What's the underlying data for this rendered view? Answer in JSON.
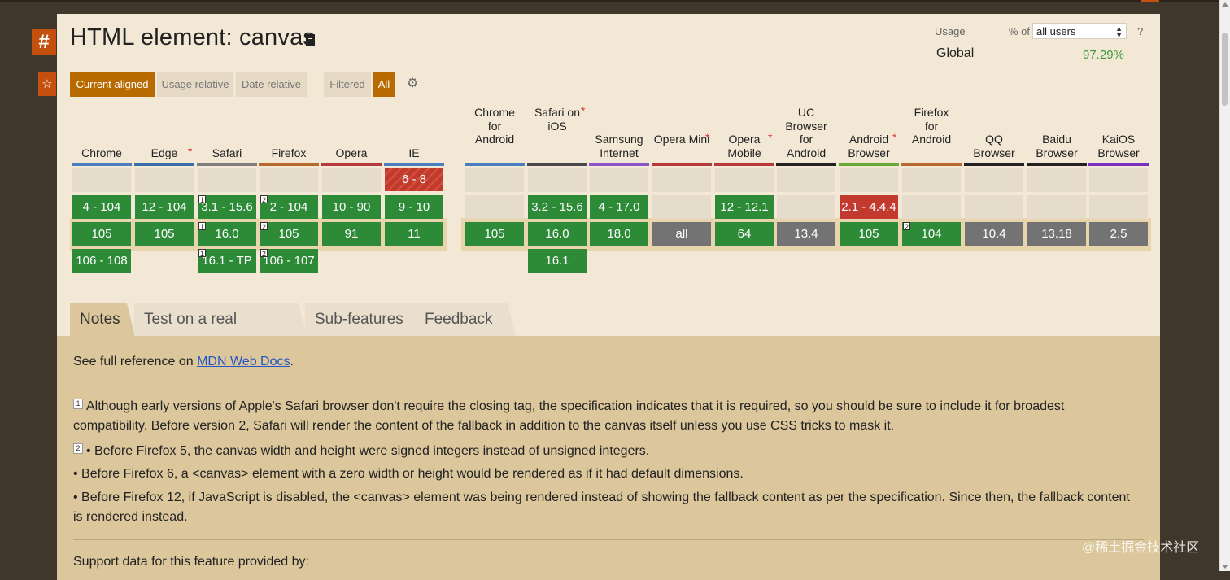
{
  "title": "HTML element: canvas",
  "anchor_label": "#",
  "star_label": "☆",
  "view_buttons": [
    "Current aligned",
    "Usage relative",
    "Date relative"
  ],
  "filter_buttons": [
    "Filtered",
    "All"
  ],
  "usage": {
    "label": "Usage",
    "pct_of": "% of",
    "users_value": "all users",
    "help": "?",
    "region": "Global",
    "percent": "97.29%"
  },
  "browsers": [
    {
      "name": "Chrome",
      "star": false,
      "color": "#4a7fbf",
      "cells": [
        "",
        "4 - 104",
        "105",
        "106 - 108"
      ],
      "notes": [
        "",
        "",
        "",
        ""
      ],
      "status": [
        "empty",
        "green",
        "green",
        "green"
      ]
    },
    {
      "name": "Edge",
      "star": true,
      "color": "#3a6ea8",
      "cells": [
        "",
        "12 - 104",
        "105",
        ""
      ],
      "notes": [
        "",
        "",
        "",
        ""
      ],
      "status": [
        "empty",
        "green",
        "green",
        "none"
      ]
    },
    {
      "name": "Safari",
      "star": false,
      "color": "#7d7d7d",
      "cells": [
        "",
        "3.1 - 15.6",
        "16.0",
        "16.1 - TP"
      ],
      "notes": [
        "",
        "1",
        "1",
        "1"
      ],
      "status": [
        "empty",
        "green",
        "green",
        "green"
      ]
    },
    {
      "name": "Firefox",
      "star": false,
      "color": "#b8692f",
      "cells": [
        "",
        "2 - 104",
        "105",
        "106 - 107"
      ],
      "notes": [
        "",
        "2",
        "2",
        "2"
      ],
      "status": [
        "empty",
        "green",
        "green",
        "green"
      ]
    },
    {
      "name": "Opera",
      "star": false,
      "color": "#b53a3a",
      "cells": [
        "",
        "10 - 90",
        "91",
        ""
      ],
      "notes": [
        "",
        "",
        "",
        ""
      ],
      "status": [
        "empty",
        "green",
        "green",
        "none"
      ]
    },
    {
      "name": "IE",
      "star": false,
      "color": "#4a7fbf",
      "cells": [
        "6 - 8",
        "9 - 10",
        "11",
        ""
      ],
      "notes": [
        "",
        "",
        "",
        ""
      ],
      "status": [
        "redh",
        "green",
        "green",
        "none"
      ]
    },
    {
      "name": "Chrome for Android",
      "star": false,
      "color": "#4a7fbf",
      "cells": [
        "",
        "",
        "105",
        ""
      ],
      "notes": [
        "",
        "",
        "",
        ""
      ],
      "status": [
        "empty",
        "empty",
        "green",
        "none"
      ]
    },
    {
      "name": "Safari on iOS",
      "star": true,
      "color": "#4a4a4a",
      "cells": [
        "",
        "3.2 - 15.6",
        "16.0",
        "16.1"
      ],
      "notes": [
        "",
        "",
        "",
        ""
      ],
      "status": [
        "empty",
        "green",
        "green",
        "green"
      ]
    },
    {
      "name": "Samsung Internet",
      "star": false,
      "color": "#8a55c8",
      "cells": [
        "",
        "4 - 17.0",
        "18.0",
        ""
      ],
      "notes": [
        "",
        "",
        "",
        ""
      ],
      "status": [
        "empty",
        "green",
        "green",
        "none"
      ]
    },
    {
      "name": "Opera Mini",
      "star": true,
      "color": "#b53a3a",
      "cells": [
        "",
        "",
        "all",
        ""
      ],
      "notes": [
        "",
        "",
        "",
        ""
      ],
      "status": [
        "empty",
        "empty",
        "gray",
        "none"
      ]
    },
    {
      "name": "Opera Mobile",
      "star": true,
      "color": "#b53a3a",
      "cells": [
        "",
        "12 - 12.1",
        "64",
        ""
      ],
      "notes": [
        "",
        "",
        "",
        ""
      ],
      "status": [
        "empty",
        "green",
        "green",
        "none"
      ]
    },
    {
      "name": "UC Browser for Android",
      "star": false,
      "color": "#222222",
      "cells": [
        "",
        "",
        "13.4",
        ""
      ],
      "notes": [
        "",
        "",
        "",
        ""
      ],
      "status": [
        "empty",
        "empty",
        "gray",
        "none"
      ]
    },
    {
      "name": "Android Browser",
      "star": true,
      "color": "#6aa83a",
      "cells": [
        "",
        "2.1 - 4.4.4",
        "105",
        ""
      ],
      "notes": [
        "",
        "",
        "",
        ""
      ],
      "status": [
        "empty",
        "red",
        "green",
        "none"
      ]
    },
    {
      "name": "Firefox for Android",
      "star": false,
      "color": "#b8692f",
      "cells": [
        "",
        "",
        "104",
        ""
      ],
      "notes": [
        "",
        "",
        "2",
        ""
      ],
      "status": [
        "empty",
        "empty",
        "green",
        "none"
      ]
    },
    {
      "name": "QQ Browser",
      "star": false,
      "color": "#222222",
      "cells": [
        "",
        "",
        "10.4",
        ""
      ],
      "notes": [
        "",
        "",
        "",
        ""
      ],
      "status": [
        "empty",
        "empty",
        "gray",
        "none"
      ]
    },
    {
      "name": "Baidu Browser",
      "star": false,
      "color": "#222222",
      "cells": [
        "",
        "",
        "13.18",
        ""
      ],
      "notes": [
        "",
        "",
        "",
        ""
      ],
      "status": [
        "empty",
        "empty",
        "gray",
        "none"
      ]
    },
    {
      "name": "KaiOS Browser",
      "star": false,
      "color": "#7a2fbf",
      "cells": [
        "",
        "",
        "2.5",
        ""
      ],
      "notes": [
        "",
        "",
        "",
        ""
      ],
      "status": [
        "empty",
        "empty",
        "gray",
        "none"
      ]
    }
  ],
  "tabs": [
    "Notes",
    "Test on a real browser",
    "Sub-features",
    "Feedback"
  ],
  "notes": {
    "ref_prefix": "See full reference on ",
    "ref_link": "MDN Web Docs",
    "ref_suffix": ".",
    "note1_num": "1",
    "note1": "Although early versions of Apple's Safari browser don't require the closing tag, the specification indicates that it is required, so you should be sure to include it for broadest compatibility. Before version 2, Safari will render the content of the fallback in addition to the canvas itself unless you use CSS tricks to mask it.",
    "note2_num": "2",
    "note2a": "• Before Firefox 5, the canvas width and height were signed integers instead of unsigned integers.",
    "note2b": "• Before Firefox 6, a <canvas> element with a zero width or height would be rendered as if it had default dimensions.",
    "note2c": "• Before Firefox 12, if JavaScript is disabled, the <canvas> element was being rendered instead of showing the fallback content as per the specification. Since then, the fallback content is rendered instead.",
    "support_by": "Support data for this feature provided by:"
  },
  "watermark": "@稀土掘金技术社区"
}
